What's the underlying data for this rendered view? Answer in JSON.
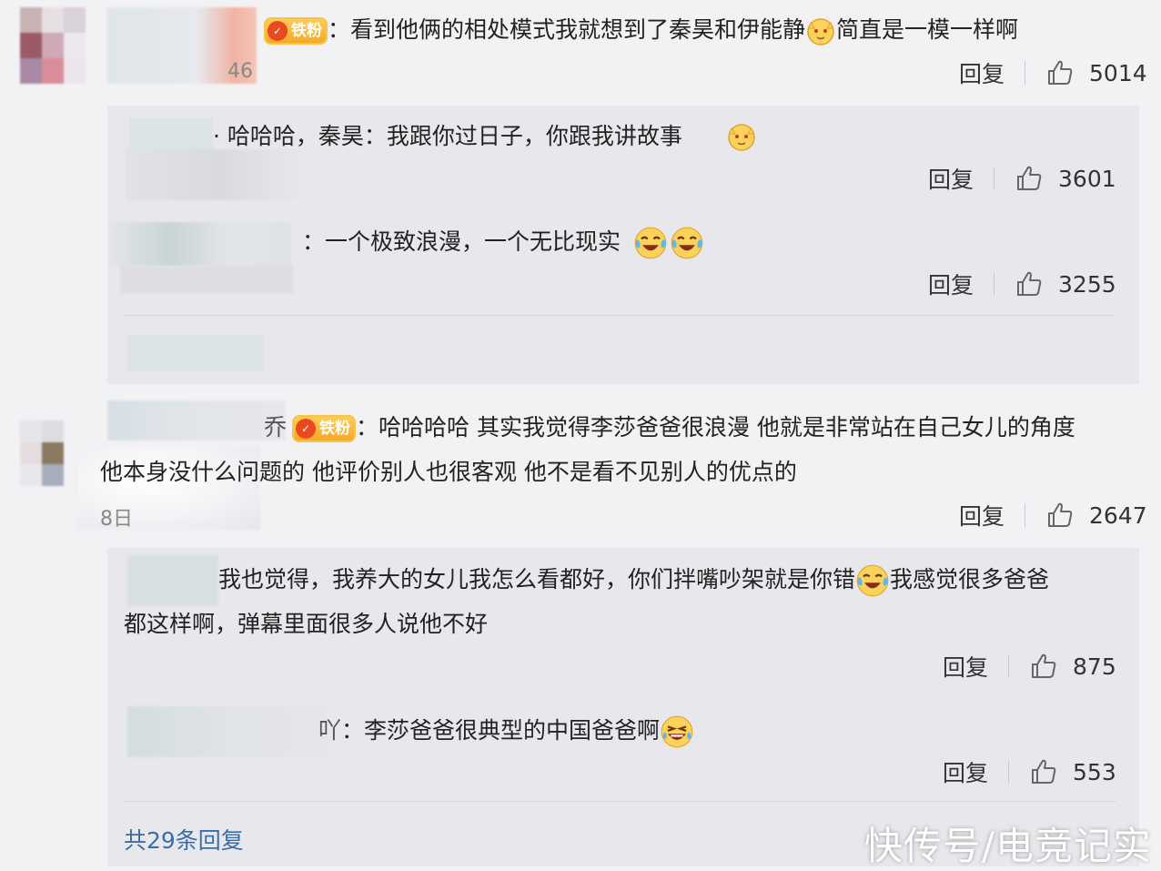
{
  "comments": [
    {
      "badge": "铁粉",
      "text": "：看到他俩的相处模式我就想到了秦昊和伊能静",
      "text_after_emoji": "简直是一模一样啊",
      "date": "46",
      "reply_label": "回复",
      "likes": "5014"
    },
    {
      "badge": "铁粉",
      "name_tail": "乔",
      "text_line1": "：哈哈哈哈 其实我觉得李莎爸爸很浪漫 他就是非常站在自己女儿的角度",
      "text_line2": "他本身没什么问题的 他评价别人也很客观 他不是看不见别人的优点的",
      "date": "8日",
      "reply_label": "回复",
      "likes": "2647"
    }
  ],
  "replies_1": [
    {
      "text": "·  哈哈哈，秦昊：我跟你过日子，你跟我讲故事",
      "reply_label": "回复",
      "likes": "3601"
    },
    {
      "text": "：一个极致浪漫，一个无比现实",
      "reply_label": "回复",
      "likes": "3255"
    }
  ],
  "replies_2": [
    {
      "text_line1": "我也觉得，我养大的女儿我怎么看都好，你们拌嘴吵架就是你错",
      "text_after_emoji": "我感觉很多爸爸",
      "text_line2": "都这样啊，弹幕里面很多人说他不好",
      "reply_label": "回复",
      "likes": "875"
    },
    {
      "name_tail": "吖",
      "text": "：李莎爸爸很典型的中国爸爸啊",
      "reply_label": "回复",
      "likes": "553"
    }
  ],
  "more_replies": "共29条回复",
  "watermark": "快传号/电竞记实",
  "colors": {
    "background": "#f2f2f5",
    "panel": "#e8e8ec",
    "link": "#3b6ea8",
    "badge": "#f5a623"
  }
}
